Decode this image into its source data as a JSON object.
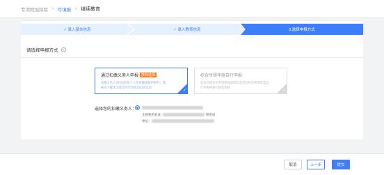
{
  "breadcrumb": {
    "items": [
      "专项附加扣除",
      "可填报",
      "继续教育"
    ]
  },
  "steps": [
    {
      "label": "✓ 录入基本信息"
    },
    {
      "label": "✓ 录入教育信息"
    },
    {
      "label": "3.选择申报方式"
    }
  ],
  "section": {
    "title": "请选择申报方式",
    "help_icon": "?"
  },
  "options": [
    {
      "title": "通过扣缴义务人申报",
      "badge": "推荐选择",
      "desc_line1": "扣缴义务人(单位)的每个人所得额填报申报时，需",
      "desc_line2": "要先下载本次提交的专项附加扣除信息"
    },
    {
      "title": "综合所得年度自行申报",
      "desc_line1": "您本次提交的专项附加扣除信息可在综合所得年度自",
      "desc_line2": "行申报中进行税前扣除"
    }
  ],
  "agent": {
    "label": "选择您的扣缴义务人：",
    "tax_no_label": "主管税务机关：",
    "tax_suffix": "税务局",
    "address_label": "地址："
  },
  "footer": {
    "cancel": "取消",
    "prev": "上一步",
    "submit": "提交"
  },
  "colors": {
    "accent": "#3d7eff",
    "badge": "#ff7a1a"
  }
}
